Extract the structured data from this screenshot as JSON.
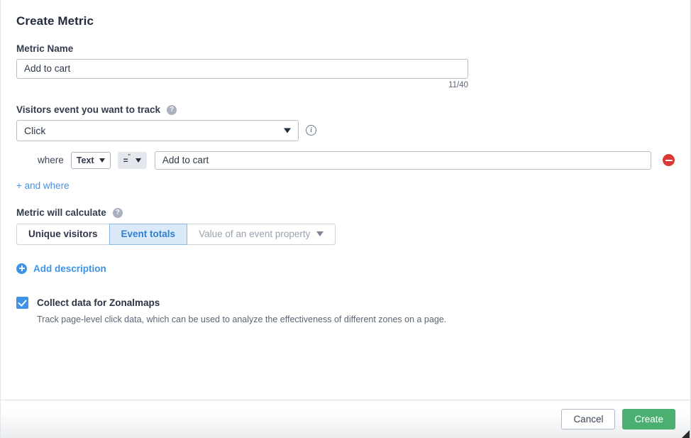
{
  "dialog": {
    "title": "Create Metric"
  },
  "metric_name": {
    "label": "Metric Name",
    "value": "Add to cart",
    "placeholder": "",
    "counter": "11/40"
  },
  "event": {
    "label": "Visitors event you want to track",
    "help_icon": "help-circle-icon",
    "info_icon": "info-circle-icon",
    "selected": "Click",
    "caret_icon": "chevron-down-icon"
  },
  "condition": {
    "where_label": "where",
    "attribute": "Text",
    "operator": "=",
    "operator_sup": "\"",
    "value": "Add to cart",
    "value_placeholder": "",
    "remove_icon": "remove-circle-icon",
    "add_link": "+ and where"
  },
  "calculate": {
    "label": "Metric will calculate",
    "help_icon": "help-circle-icon",
    "options": [
      {
        "label": "Unique visitors",
        "state": "normal"
      },
      {
        "label": "Event totals",
        "state": "active"
      },
      {
        "label": "Value of an event property",
        "state": "disabled"
      }
    ]
  },
  "description": {
    "add_label": "Add description",
    "plus_icon": "plus-circle-icon"
  },
  "zonalmaps": {
    "checked": true,
    "label": "Collect data for Zonalmaps",
    "help_text": "Track page-level click data, which can be used to analyze the effectiveness of different zones on a page."
  },
  "footer": {
    "cancel_label": "Cancel",
    "create_label": "Create"
  },
  "colors": {
    "accent_blue": "#3d93e8",
    "active_seg_bg": "#dbeaf9",
    "create_green": "#4caf72",
    "remove_red": "#d93a34"
  }
}
